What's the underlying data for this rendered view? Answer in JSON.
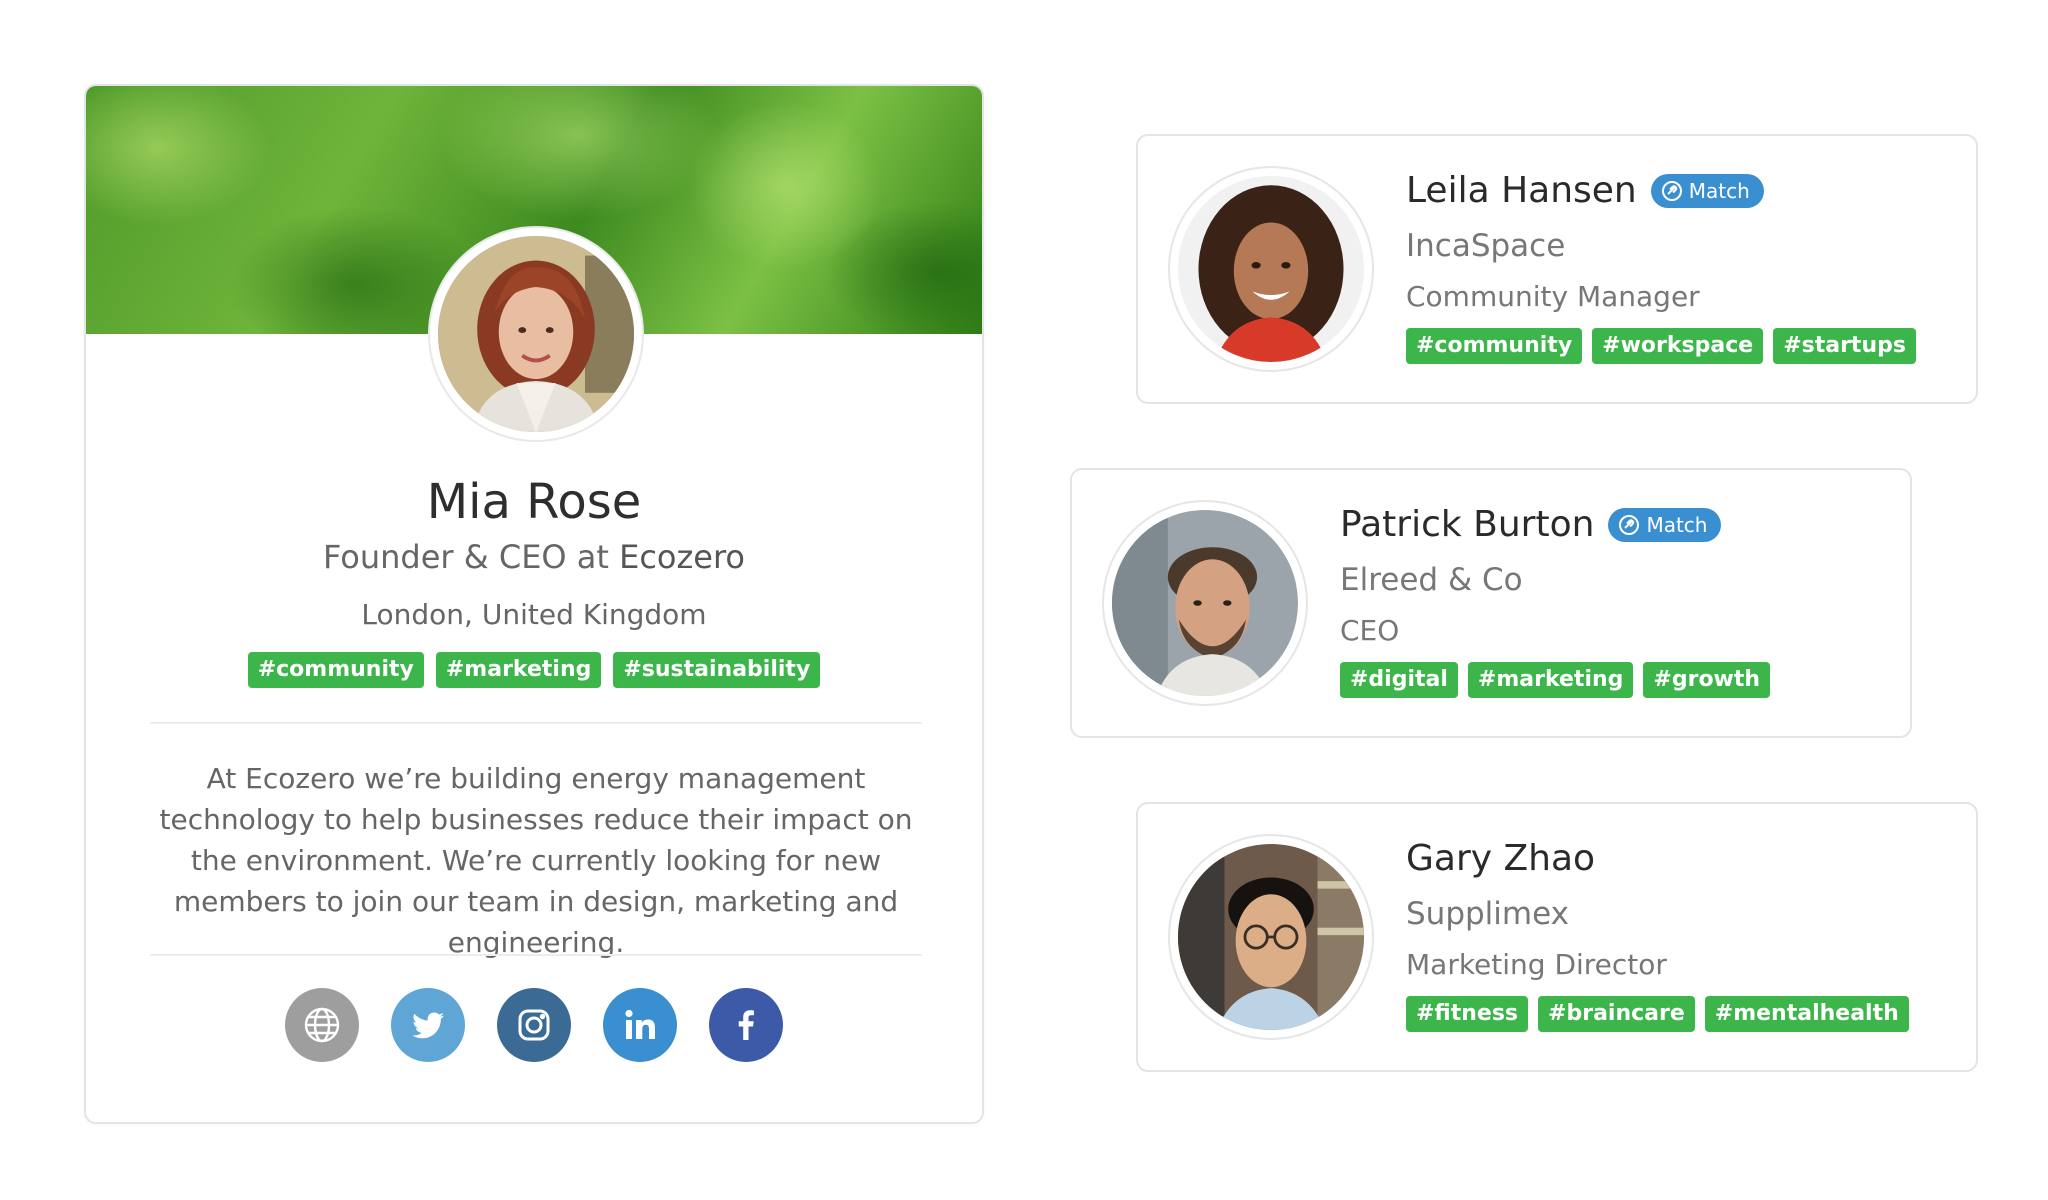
{
  "profile": {
    "name": "Mia Rose",
    "role_prefix": "Founder & CEO at ",
    "company": "Ecozero",
    "location": "London, United Kingdom",
    "tags": [
      "#community",
      "#marketing",
      "#sustainability"
    ],
    "bio": "At Ecozero we’re building energy management technology to help businesses reduce their impact on the environment. We’re currently looking for new members to join our team in design, marketing and engineering.",
    "socials": [
      {
        "icon": "globe-icon",
        "color": "#9e9e9e"
      },
      {
        "icon": "twitter-icon",
        "color": "#5fa5d6"
      },
      {
        "icon": "instagram-icon",
        "color": "#3b6b95"
      },
      {
        "icon": "linkedin-icon",
        "color": "#3a8fd0"
      },
      {
        "icon": "facebook-icon",
        "color": "#3d5aa8"
      }
    ]
  },
  "matches": [
    {
      "name": "Leila Hansen",
      "badge": "Match",
      "company": "IncaSpace",
      "title": "Community Manager",
      "tags": [
        "#community",
        "#workspace",
        "#startups"
      ]
    },
    {
      "name": "Patrick Burton",
      "badge": "Match",
      "company": "Elreed & Co",
      "title": "CEO",
      "tags": [
        "#digital",
        "#marketing",
        "#growth"
      ]
    },
    {
      "name": "Gary Zhao",
      "badge": "",
      "company": "Supplimex",
      "title": "Marketing Director",
      "tags": [
        "#fitness",
        "#braincare",
        "#mentalhealth"
      ]
    }
  ],
  "colors": {
    "tag_green": "#3cb64a",
    "match_blue": "#3a8fd0"
  }
}
